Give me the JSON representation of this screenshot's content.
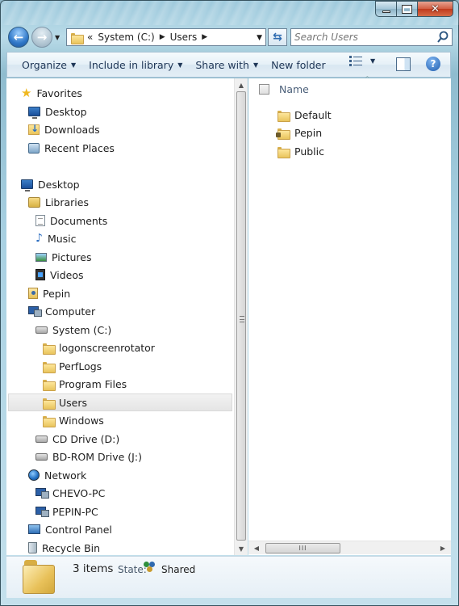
{
  "address": {
    "overflow": "«",
    "crumbs": [
      "System (C:)",
      "Users"
    ]
  },
  "search": {
    "placeholder": "Search Users"
  },
  "toolbar": {
    "organize": "Organize",
    "include": "Include in library",
    "share": "Share with",
    "new_folder": "New folder"
  },
  "nav": {
    "favorites": "Favorites",
    "desktop_fav": "Desktop",
    "downloads": "Downloads",
    "recent": "Recent Places",
    "desktop": "Desktop",
    "libraries": "Libraries",
    "documents": "Documents",
    "music": "Music",
    "pictures": "Pictures",
    "videos": "Videos",
    "pepin": "Pepin",
    "computer": "Computer",
    "system_c": "System (C:)",
    "logon": "logonscreenrotator",
    "perflogs": "PerfLogs",
    "program_files": "Program Files",
    "users": "Users",
    "windows": "Windows",
    "cd_drive": "CD Drive (D:)",
    "bdrom": "BD-ROM Drive (J:)",
    "network": "Network",
    "chevo": "CHEVO-PC",
    "pepin_pc": "PEPIN-PC",
    "control_panel": "Control Panel",
    "recycle": "Recycle Bin"
  },
  "content": {
    "column_name": "Name",
    "items": [
      "Default",
      "Pepin",
      "Public"
    ]
  },
  "details": {
    "count": "3 items",
    "state_label": "State:",
    "state_value": "Shared"
  },
  "icons": {
    "colors": {
      "accent": "#1f5cae",
      "folder": "#e9c45c",
      "selection": "#e5e5e5"
    }
  }
}
